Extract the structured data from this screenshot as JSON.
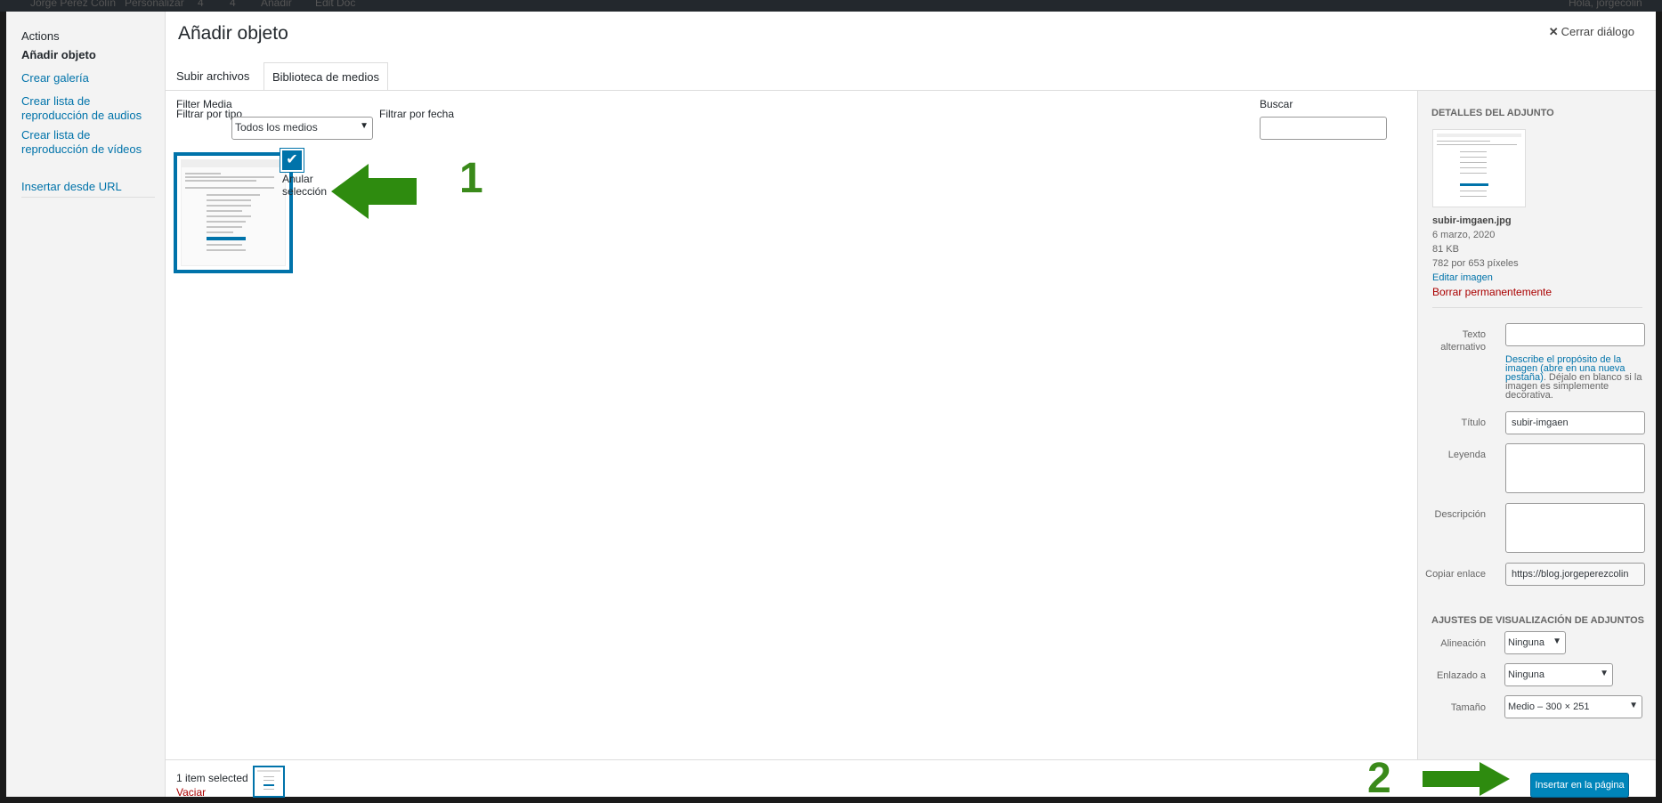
{
  "adminbar": {
    "site": "Jorge Pérez Colín",
    "customize": "Personalizar",
    "updates": "4",
    "comments": "4",
    "new": "Añadir",
    "edit": "Edit Doc",
    "greeting": "Hola, jorgecolin"
  },
  "menu": {
    "heading": "Actions",
    "items": [
      {
        "label": "Añadir objeto"
      },
      {
        "label": "Crear galería"
      },
      {
        "label": "Crear lista de reproducción de audios"
      },
      {
        "label": "Crear lista de reproducción de vídeos"
      },
      {
        "label": "Insertar desde URL"
      }
    ]
  },
  "dialog": {
    "title": "Añadir objeto",
    "close_label": "Cerrar diálogo"
  },
  "tabs": [
    {
      "label": "Subir archivos"
    },
    {
      "label": "Biblioteca de medios"
    }
  ],
  "filters": {
    "heading": "Filter Media",
    "type_label": "Filtrar por tipo",
    "type_value": "Todos los medios",
    "date_label": "Filtrar por fecha",
    "search_label": "Buscar",
    "search_value": ""
  },
  "grid": {
    "check_label": "Anular selección"
  },
  "annotations": {
    "step1": "1",
    "step2": "2",
    "arrow_color": "#2e8b0f"
  },
  "details": {
    "heading": "Detalles del adjunto",
    "filename": "subir-imgaen.jpg",
    "date": "6 marzo, 2020",
    "size": "81 KB",
    "dimensions": "782 por 653 píxeles",
    "edit_link": "Editar imagen",
    "delete_link": "Borrar permanentemente",
    "alt_label": "Texto alternativo",
    "alt_value": "",
    "alt_help_link": "Describe el propósito de la imagen (abre en una nueva pestaña)",
    "alt_help_text": ". Déjalo en blanco si la imagen es simplemente decorativa.",
    "title_label": "Título",
    "title_value": "subir-imgaen",
    "caption_label": "Leyenda",
    "description_label": "Descripción",
    "copy_label": "Copiar enlace",
    "copy_value": "https://blog.jorgeperezcolin"
  },
  "display": {
    "heading": "Ajustes de visualización de adjuntos",
    "align_label": "Alineación",
    "align_value": "Ninguna",
    "link_label": "Enlazado a",
    "link_value": "Ninguna",
    "size_label": "Tamaño",
    "size_value": "Medio – 300 × 251"
  },
  "footer": {
    "count": "1 item selected",
    "clear": "Vaciar",
    "insert_button": "Insertar en la página"
  }
}
